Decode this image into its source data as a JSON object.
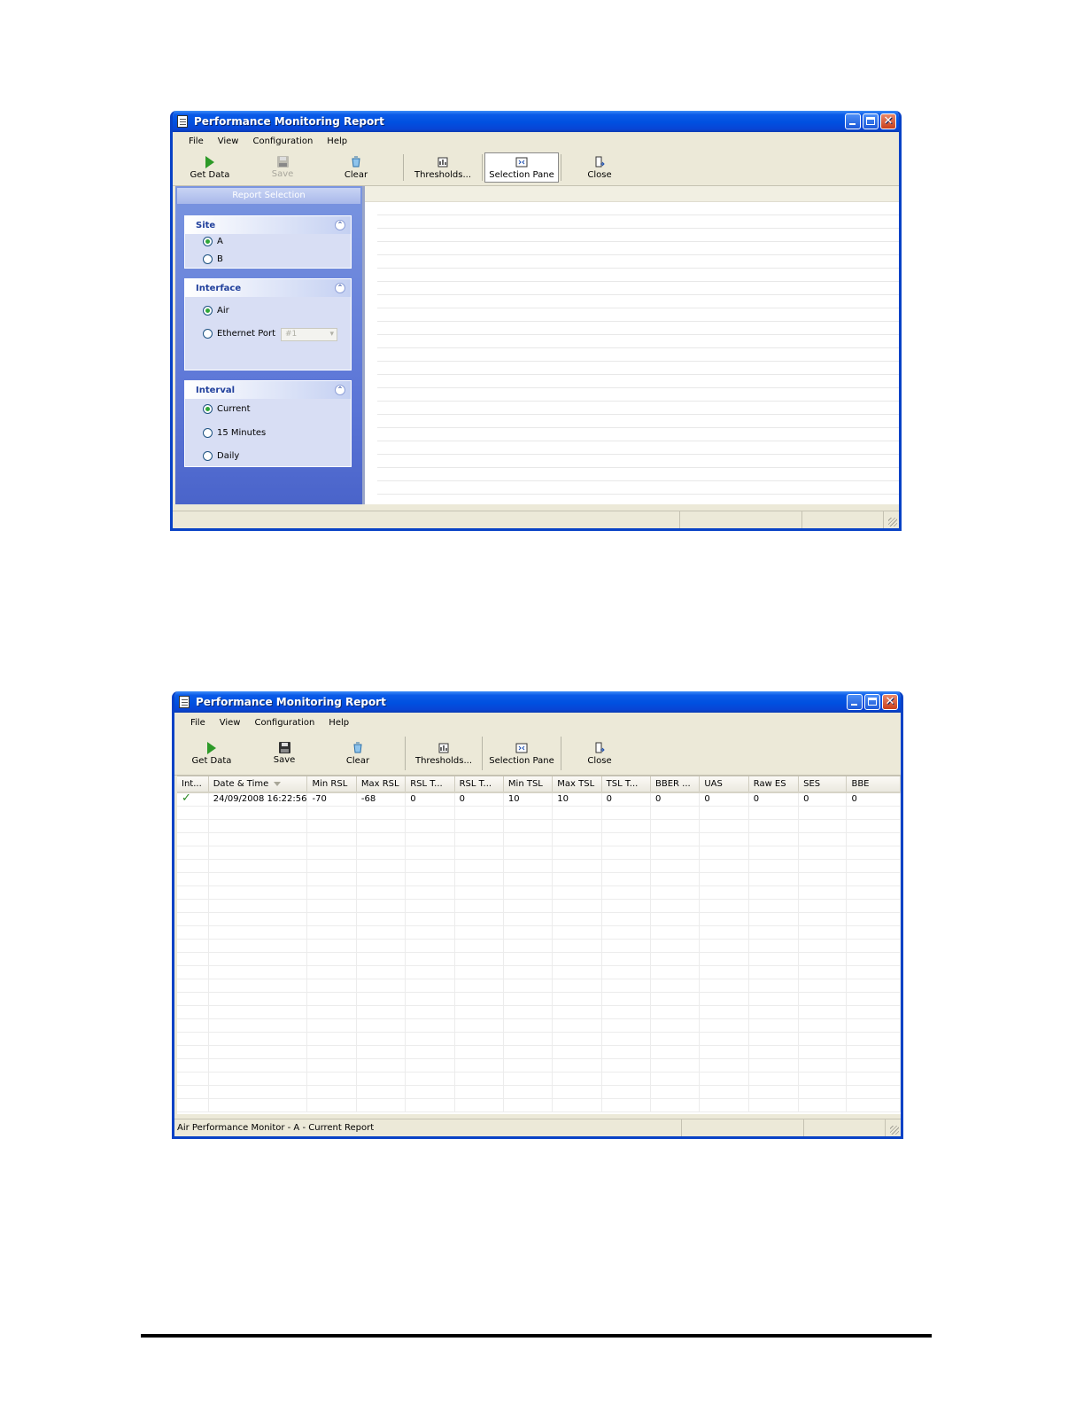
{
  "window1": {
    "title": "Performance Monitoring Report",
    "menu": [
      "File",
      "View",
      "Configuration",
      "Help"
    ],
    "toolbar": {
      "get_data": "Get Data",
      "save": "Save",
      "clear": "Clear",
      "thresholds": "Thresholds...",
      "selection_pane": "Selection Pane",
      "close": "Close"
    },
    "pane_title": "Report Selection",
    "site": {
      "title": "Site",
      "options": [
        "A",
        "B"
      ],
      "selected": "A"
    },
    "interface": {
      "title": "Interface",
      "options": [
        "Air",
        "Ethernet Port"
      ],
      "selected": "Air",
      "port_value": "#1"
    },
    "interval": {
      "title": "Interval",
      "options": [
        "Current",
        "15 Minutes",
        "Daily"
      ],
      "selected": "Current"
    },
    "status": ""
  },
  "window2": {
    "title": "Performance Monitoring Report",
    "menu": [
      "File",
      "View",
      "Configuration",
      "Help"
    ],
    "toolbar": {
      "get_data": "Get Data",
      "save": "Save",
      "clear": "Clear",
      "thresholds": "Thresholds...",
      "selection_pane": "Selection Pane",
      "close": "Close"
    },
    "table": {
      "columns": [
        "Int...",
        "Date & Time",
        "Min RSL",
        "Max RSL",
        "RSL T...",
        "RSL T...",
        "Min TSL",
        "Max TSL",
        "TSL T...",
        "BBER ...",
        "UAS",
        "Raw ES",
        "SES",
        "BBE"
      ],
      "rows": [
        [
          "",
          "24/09/2008 16:22:56",
          "-70",
          "-68",
          "0",
          "0",
          "10",
          "10",
          "0",
          "0",
          "0",
          "0",
          "0",
          "0"
        ]
      ]
    },
    "status": "Air Performance Monitor - A - Current Report"
  }
}
